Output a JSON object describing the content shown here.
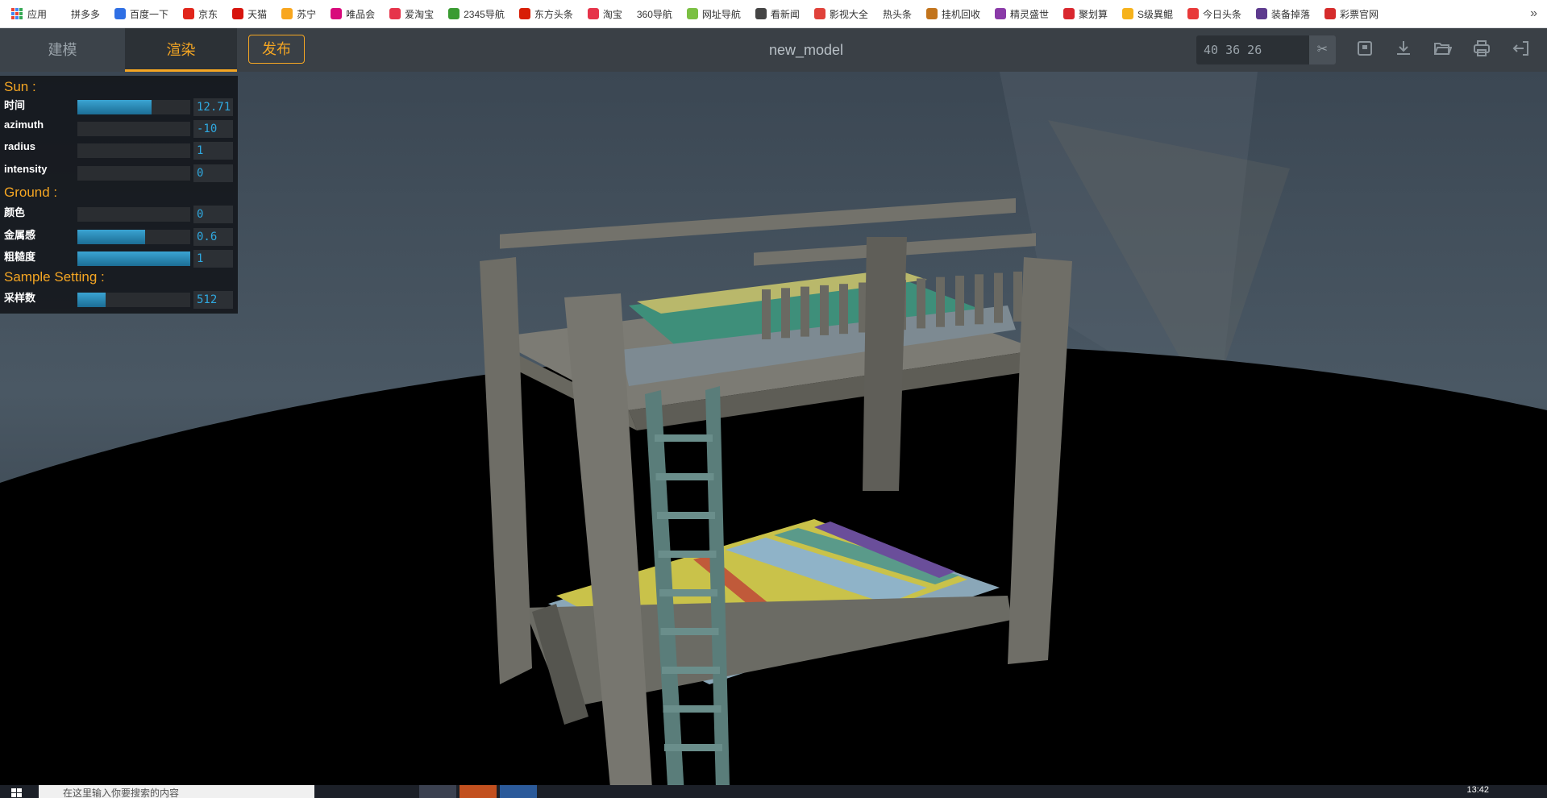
{
  "bookmarks": {
    "items": [
      {
        "label": "应用",
        "icon": "apps-grid-icon",
        "color": "#e94235"
      },
      {
        "label": "拼多多",
        "icon": "none",
        "color": ""
      },
      {
        "label": "百度一下",
        "icon": "baidu-paw-icon",
        "color": "#2f6fe4"
      },
      {
        "label": "京东",
        "icon": "jd-icon",
        "color": "#e1251b"
      },
      {
        "label": "天猫",
        "icon": "tmall-icon",
        "color": "#d7140d"
      },
      {
        "label": "苏宁",
        "icon": "suning-icon",
        "color": "#f8a61e"
      },
      {
        "label": "唯品会",
        "icon": "vip-icon",
        "color": "#d8097b"
      },
      {
        "label": "爱淘宝",
        "icon": "taobao-icon",
        "color": "#e6334a"
      },
      {
        "label": "2345导航",
        "icon": "2345-icon",
        "color": "#3a9b32"
      },
      {
        "label": "东方头条",
        "icon": "dftt-icon",
        "color": "#d81e06"
      },
      {
        "label": "淘宝",
        "icon": "taobao-icon",
        "color": "#e6334a"
      },
      {
        "label": "360导航",
        "icon": "none",
        "color": ""
      },
      {
        "label": "网址导航",
        "icon": "7654-icon",
        "color": "#7bc043"
      },
      {
        "label": "看新闻",
        "icon": "globe-icon",
        "color": "#444444"
      },
      {
        "label": "影视大全",
        "icon": "play-icon",
        "color": "#e0413a"
      },
      {
        "label": "热头条",
        "icon": "none",
        "color": ""
      },
      {
        "label": "挂机回收",
        "icon": "game-icon",
        "color": "#c2741c"
      },
      {
        "label": "精灵盛世",
        "icon": "elf-icon",
        "color": "#8a3aa8"
      },
      {
        "label": "聚划算",
        "icon": "juhuasuan-icon",
        "color": "#d9272e"
      },
      {
        "label": "S级異鲲",
        "icon": "coin-icon",
        "color": "#f6b21b"
      },
      {
        "label": "今日头条",
        "icon": "toutiao-icon",
        "color": "#e83939"
      },
      {
        "label": "装备掉落",
        "icon": "gear-drop-icon",
        "color": "#5d3a8e"
      },
      {
        "label": "彩票官网",
        "icon": "lottery-icon",
        "color": "#d52b2b"
      }
    ],
    "more": "»"
  },
  "topbar": {
    "tab_model": "建模",
    "tab_render": "渲染",
    "publish": "发布",
    "title": "new_model",
    "dims": "40 36 26",
    "accent": "#f5a623"
  },
  "toolbar_icons": [
    "cut-icon",
    "save-icon",
    "download-icon",
    "open-folder-icon",
    "print-icon",
    "exit-icon"
  ],
  "progress": 0.125,
  "settings": {
    "sun_title": "Sun :",
    "ground_title": "Ground :",
    "sample_title": "Sample Setting :",
    "rows": [
      {
        "label": "时间",
        "value": "12.71",
        "fill": 0.66
      },
      {
        "label": "azimuth",
        "value": "-10",
        "fill": 0
      },
      {
        "label": "radius",
        "value": "1",
        "fill": 0
      },
      {
        "label": "intensity",
        "value": "0",
        "fill": 0
      },
      {
        "label": "颜色",
        "value": "0",
        "fill": 0
      },
      {
        "label": "金属感",
        "value": "0.6",
        "fill": 0.6
      },
      {
        "label": "粗糙度",
        "value": "1",
        "fill": 1
      },
      {
        "label": "采样数",
        "value": "512",
        "fill": 0.25
      }
    ]
  },
  "taskbar": {
    "search_placeholder": "在这里输入你要搜索的内容",
    "clock": "13:42"
  }
}
